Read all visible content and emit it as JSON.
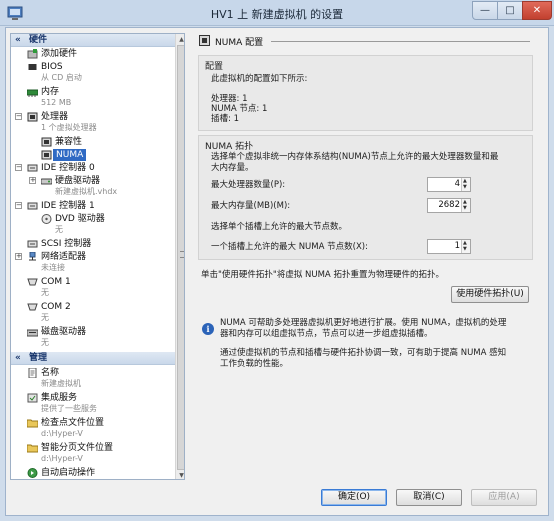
{
  "window": {
    "title": "HV1 上 新建虚拟机 的设置",
    "min": "—",
    "max": "□",
    "close": "✕"
  },
  "tree": {
    "hardware_header": "硬件",
    "management_header": "管理",
    "hardware": [
      {
        "label": "添加硬件",
        "sub": ""
      },
      {
        "label": "BIOS",
        "sub": "从 CD 启动"
      },
      {
        "label": "内存",
        "sub": "512 MB"
      },
      {
        "label": "处理器",
        "sub": "1 个虚拟处理器"
      },
      {
        "label": "兼容性",
        "sub": ""
      },
      {
        "label": "NUMA",
        "sub": ""
      },
      {
        "label": "IDE 控制器 0",
        "sub": ""
      },
      {
        "label": "硬盘驱动器",
        "sub": "新建虚拟机.vhdx"
      },
      {
        "label": "IDE 控制器 1",
        "sub": ""
      },
      {
        "label": "DVD 驱动器",
        "sub": "无"
      },
      {
        "label": "SCSI 控制器",
        "sub": ""
      },
      {
        "label": "网络适配器",
        "sub": "未连接"
      },
      {
        "label": "COM 1",
        "sub": "无"
      },
      {
        "label": "COM 2",
        "sub": "无"
      },
      {
        "label": "磁盘驱动器",
        "sub": "无"
      }
    ],
    "management": [
      {
        "label": "名称",
        "sub": "新建虚拟机"
      },
      {
        "label": "集成服务",
        "sub": "提供了一些服务"
      },
      {
        "label": "检查点文件位置",
        "sub": "d:\\Hyper-V"
      },
      {
        "label": "智能分页文件位置",
        "sub": "d:\\Hyper-V"
      },
      {
        "label": "自动启动操作",
        "sub": ""
      }
    ]
  },
  "panel": {
    "title": "NUMA 配置",
    "config": {
      "title": "配置",
      "intro": "此虚拟机的配置如下所示:",
      "processors": "处理器: 1",
      "numa_nodes": "NUMA 节点: 1",
      "sockets": "插槽: 1"
    },
    "topology": {
      "title": "NUMA 拓扑",
      "desc_line1": "选择单个虚拟非统一内存体系结构(NUMA)节点上允许的最大处理器数量和最",
      "desc_line2": "大内存量。",
      "max_proc_label": "最大处理器数量(P):",
      "max_proc_value": "4",
      "max_mem_label": "最大内存量(MB)(M):",
      "max_mem_value": "2682",
      "socket_desc": "选择单个插槽上允许的最大节点数。",
      "max_nodes_label": "一个插槽上允许的最大 NUMA 节点数(X):",
      "max_nodes_value": "1"
    },
    "reset_text": "单击\"使用硬件拓扑\"将虚拟 NUMA 拓扑重置为物理硬件的拓扑。",
    "use_hw_button": "使用硬件拓扑(U)",
    "info_line1": "NUMA 可帮助多处理器虚拟机更好地进行扩展。使用 NUMA，虚拟机的处理",
    "info_line2": "器和内存可以组虚拟节点，节点可以进一步组虚拟插槽。",
    "info_line3": "通过使虚拟机的节点和插槽与硬件拓扑协调一致，可有助于提高 NUMA 感知",
    "info_line4": "工作负载的性能。"
  },
  "buttons": {
    "ok": "确定(O)",
    "cancel": "取消(C)",
    "apply": "应用(A)"
  }
}
